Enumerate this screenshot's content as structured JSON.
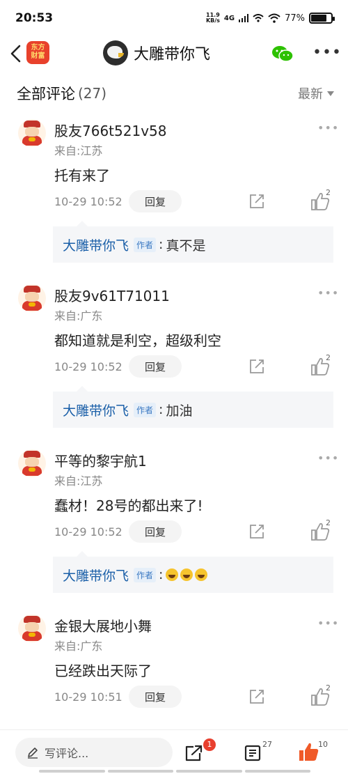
{
  "status_bar": {
    "time": "20:53",
    "net_speed_value": "11.9",
    "net_speed_unit": "KB/s",
    "signal_label": "4G",
    "battery": "77%",
    "battery_level": 0.77
  },
  "nav": {
    "app_logo_line1": "东方",
    "app_logo_line2": "财富",
    "author_name": "大雕带你飞",
    "more_label": "•••"
  },
  "section": {
    "title": "全部评论",
    "count": "(27)",
    "sort_label": "最新"
  },
  "author_tag": "作者",
  "reply_label": "回复",
  "more_dots": "•••",
  "comments": [
    {
      "user": "股友766t521v58",
      "location": "来自:江苏",
      "text": "托有来了",
      "time": "10-29 10:52",
      "likes": "2",
      "reply": {
        "author": "大雕带你飞",
        "text": "真不是"
      }
    },
    {
      "user": "股友9v61T71011",
      "location": "来自:广东",
      "text": "都知道就是利空，超级利空",
      "time": "10-29 10:52",
      "likes": "2",
      "reply": {
        "author": "大雕带你飞",
        "text": "加油"
      }
    },
    {
      "user": "平等的黎宇航1",
      "location": "来自:江苏",
      "text": "蠢材！28号的都出来了!",
      "time": "10-29 10:52",
      "likes": "2",
      "reply": {
        "author": "大雕带你飞",
        "emoji_count": 3
      }
    },
    {
      "user": "金银大展地小舞",
      "location": "来自:广东",
      "text": "已经跌出天际了",
      "time": "10-29 10:51",
      "likes": "2"
    }
  ],
  "bottom_bar": {
    "compose_placeholder": "写评论...",
    "share_badge": "1",
    "list_count": "27",
    "like_count": "10"
  },
  "colors": {
    "accent_blue": "#1a5fa8",
    "like_orange": "#f05a28",
    "badge_red": "#e8402f"
  }
}
